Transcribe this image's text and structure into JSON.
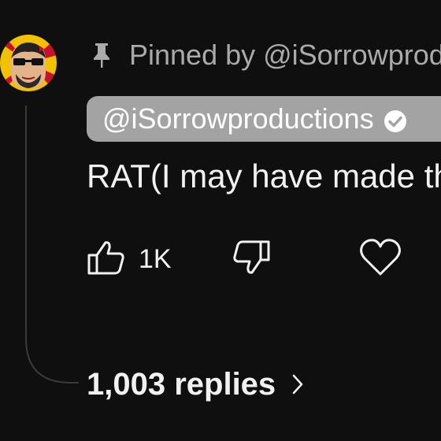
{
  "comment": {
    "pinned_label": "Pinned by @iSorrowproductions",
    "author": "@iSorrowproductions",
    "text": "RAT(I may have made this)",
    "like_count": "1K",
    "replies_label": "1,003 replies"
  },
  "icons": {
    "pin": "pin-icon",
    "verified": "verified-check-icon",
    "like": "thumbs-up-icon",
    "dislike": "thumbs-down-icon",
    "heart": "heart-icon",
    "replies_chevron": "chevron-right-icon"
  },
  "colors": {
    "background": "#0f0f0f",
    "text_primary": "#f1f1f1",
    "text_secondary": "#aaaaaa",
    "author_chip": "#a3a3a3",
    "avatar_yellow": "#f2c200",
    "avatar_red": "#c8102e"
  }
}
